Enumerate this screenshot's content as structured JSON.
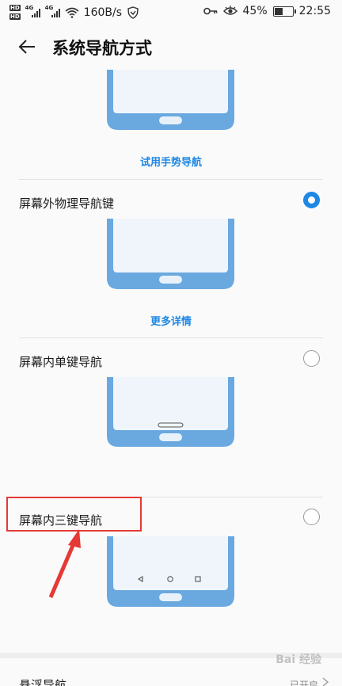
{
  "status_bar": {
    "network_speed": "160B/s",
    "battery_percent": "45%",
    "time": "22:55",
    "hd_label": "HD",
    "network_type": "4G",
    "battery_level": 0.45
  },
  "header": {
    "title": "系统导航方式"
  },
  "gesture": {
    "try_link": "试用手势导航"
  },
  "options": [
    {
      "label": "屏幕外物理导航键",
      "selected": true,
      "link": "更多详情"
    },
    {
      "label": "屏幕内单键导航",
      "selected": false
    },
    {
      "label": "屏幕内三键导航",
      "selected": false
    }
  ],
  "floating_nav": {
    "label": "悬浮导航",
    "status": "已开启"
  },
  "watermark": "Bai 经验",
  "colors": {
    "accent": "#1e88e5",
    "phone_body": "#6aa8e0",
    "highlight": "#e53935"
  }
}
